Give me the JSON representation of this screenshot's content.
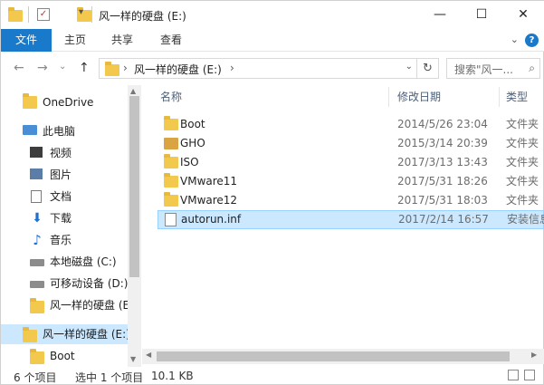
{
  "window": {
    "title": "风一样的硬盘 (E:)",
    "minimize": "—",
    "maximize": "☐",
    "close": "✕"
  },
  "ribbon": {
    "tabs": [
      "文件",
      "主页",
      "共享",
      "查看"
    ],
    "help": "?"
  },
  "nav": {
    "back": "←",
    "forward": "→",
    "recent": "⌄",
    "up": "↑",
    "address_path": "风一样的硬盘 (E:)",
    "address_sep": "›",
    "address_sep2": "›",
    "refresh": "↻",
    "search_placeholder": "搜索\"风一..."
  },
  "sidebar": {
    "items": [
      {
        "label": "OneDrive",
        "icon": "onedrive-folder-icon"
      },
      {
        "label": "此电脑",
        "icon": "this-pc-icon"
      },
      {
        "label": "视频",
        "icon": "videos-icon"
      },
      {
        "label": "图片",
        "icon": "pictures-icon"
      },
      {
        "label": "文档",
        "icon": "documents-icon"
      },
      {
        "label": "下载",
        "icon": "downloads-icon"
      },
      {
        "label": "音乐",
        "icon": "music-icon"
      },
      {
        "label": "本地磁盘 (C:)",
        "icon": "local-disk-icon"
      },
      {
        "label": "可移动设备 (D:)",
        "icon": "removable-drive-icon"
      },
      {
        "label": "风一样的硬盘 (E:",
        "icon": "folder-icon"
      },
      {
        "label": "风一样的硬盘 (E:)",
        "icon": "folder-icon"
      },
      {
        "label": "Boot",
        "icon": "folder-icon"
      }
    ]
  },
  "columns": {
    "name": "名称",
    "modified": "修改日期",
    "type": "类型",
    "sort_indicator": "^"
  },
  "files": [
    {
      "name": "Boot",
      "date": "2014/5/26 23:04",
      "type": "文件夹",
      "icon": "folder-icon"
    },
    {
      "name": "GHO",
      "date": "2015/3/14 20:39",
      "type": "文件夹",
      "icon": "gho-folder-icon"
    },
    {
      "name": "ISO",
      "date": "2017/3/13 13:43",
      "type": "文件夹",
      "icon": "folder-icon"
    },
    {
      "name": "VMware11",
      "date": "2017/5/31 18:26",
      "type": "文件夹",
      "icon": "folder-icon"
    },
    {
      "name": "VMware12",
      "date": "2017/5/31 18:03",
      "type": "文件夹",
      "icon": "folder-icon"
    },
    {
      "name": "autorun.inf",
      "date": "2017/2/14 16:57",
      "type": "安装信息",
      "icon": "inf-file-icon",
      "selected": true
    }
  ],
  "status": {
    "count": "6 个项目",
    "selected": "选中 1 个项目",
    "size": "10.1 KB"
  },
  "colors": {
    "accent": "#1979ca",
    "selection": "#cce8ff",
    "folder": "#f2c94c"
  }
}
